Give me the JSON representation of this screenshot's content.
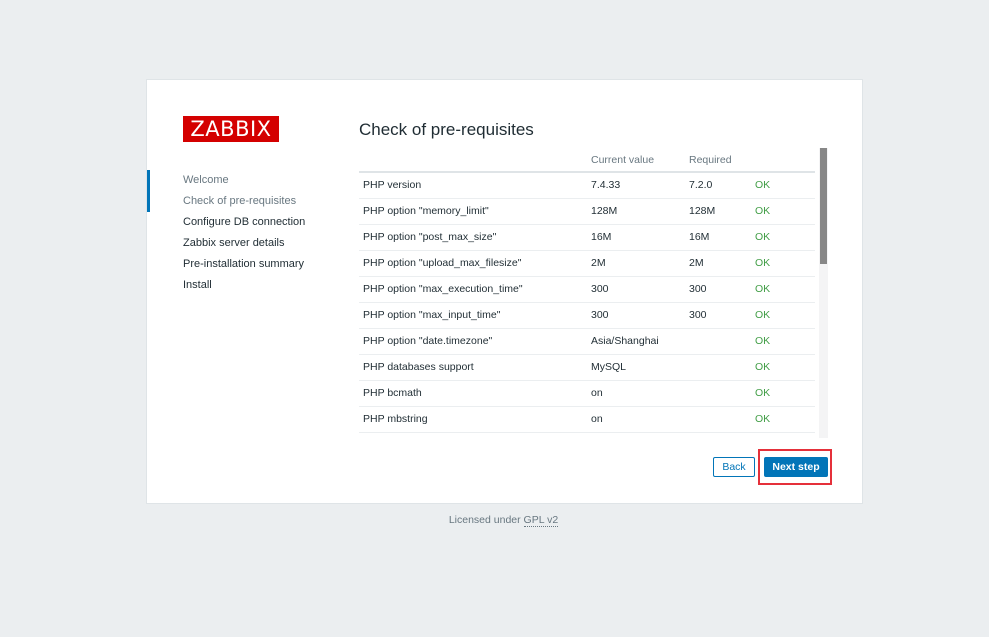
{
  "logo": {
    "text": "ZABBIX"
  },
  "steps": [
    {
      "label": "Welcome",
      "state": "done"
    },
    {
      "label": "Check of pre-requisites",
      "state": "current"
    },
    {
      "label": "Configure DB connection",
      "state": "pending"
    },
    {
      "label": "Zabbix server details",
      "state": "pending"
    },
    {
      "label": "Pre-installation summary",
      "state": "pending"
    },
    {
      "label": "Install",
      "state": "pending"
    }
  ],
  "title": "Check of pre-requisites",
  "table": {
    "headers": [
      "",
      "Current value",
      "Required",
      ""
    ],
    "rows": [
      {
        "name": "PHP version",
        "current": "7.4.33",
        "required": "7.2.0",
        "status": "OK"
      },
      {
        "name": "PHP option \"memory_limit\"",
        "current": "128M",
        "required": "128M",
        "status": "OK"
      },
      {
        "name": "PHP option \"post_max_size\"",
        "current": "16M",
        "required": "16M",
        "status": "OK"
      },
      {
        "name": "PHP option \"upload_max_filesize\"",
        "current": "2M",
        "required": "2M",
        "status": "OK"
      },
      {
        "name": "PHP option \"max_execution_time\"",
        "current": "300",
        "required": "300",
        "status": "OK"
      },
      {
        "name": "PHP option \"max_input_time\"",
        "current": "300",
        "required": "300",
        "status": "OK"
      },
      {
        "name": "PHP option \"date.timezone\"",
        "current": "Asia/Shanghai",
        "required": "",
        "status": "OK"
      },
      {
        "name": "PHP databases support",
        "current": "MySQL",
        "required": "",
        "status": "OK"
      },
      {
        "name": "PHP bcmath",
        "current": "on",
        "required": "",
        "status": "OK"
      },
      {
        "name": "PHP mbstring",
        "current": "on",
        "required": "",
        "status": "OK"
      }
    ]
  },
  "buttons": {
    "back": "Back",
    "next": "Next step"
  },
  "footer": {
    "text": "Licensed under ",
    "link": "GPL v2"
  },
  "colors": {
    "accent": "#0275b8",
    "ok": "#429e47",
    "brand": "#d40000",
    "highlight": "#e5303a"
  }
}
